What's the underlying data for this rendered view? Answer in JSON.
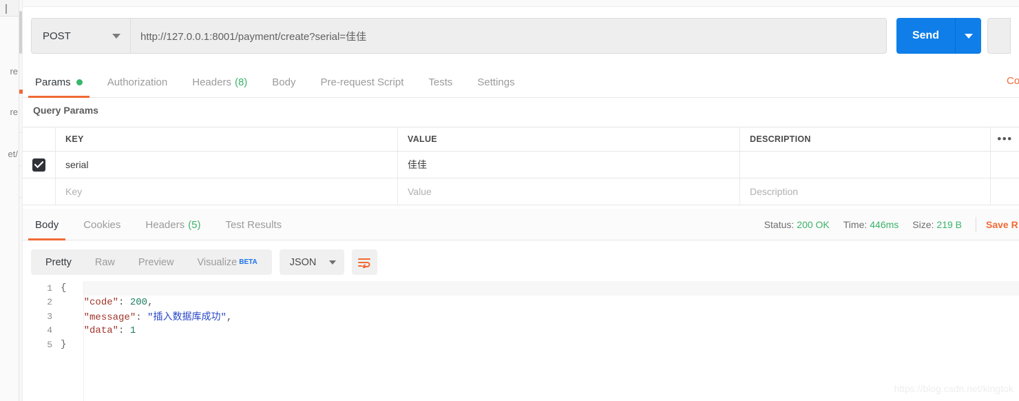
{
  "sidebar": {
    "clipped_labels": [
      "re",
      "re",
      "et/"
    ]
  },
  "request": {
    "method": "POST",
    "method_caret_icon": "chevron-down-icon",
    "url": "http://127.0.0.1:8001/payment/create?serial=佳佳",
    "send_label": "Send",
    "send_caret_icon": "chevron-down-icon"
  },
  "request_tabs": [
    {
      "label": "Params",
      "badge": "",
      "dot": true,
      "active": true
    },
    {
      "label": "Authorization",
      "badge": "",
      "dot": false,
      "active": false
    },
    {
      "label": "Headers",
      "badge": "(8)",
      "dot": false,
      "active": false
    },
    {
      "label": "Body",
      "badge": "",
      "dot": false,
      "active": false
    },
    {
      "label": "Pre-request Script",
      "badge": "",
      "dot": false,
      "active": false
    },
    {
      "label": "Tests",
      "badge": "",
      "dot": false,
      "active": false
    },
    {
      "label": "Settings",
      "badge": "",
      "dot": false,
      "active": false
    }
  ],
  "cookies_link": "Co",
  "query_params": {
    "title": "Query Params",
    "columns": [
      "KEY",
      "VALUE",
      "DESCRIPTION"
    ],
    "bulk_edit_icon": "ellipsis-icon",
    "rows": [
      {
        "checked": true,
        "key": "serial",
        "value": "佳佳",
        "description": ""
      }
    ],
    "placeholder_row": {
      "key": "Key",
      "value": "Value",
      "description": "Description"
    }
  },
  "response_tabs": [
    {
      "label": "Body",
      "badge": "",
      "active": true
    },
    {
      "label": "Cookies",
      "badge": "",
      "active": false
    },
    {
      "label": "Headers",
      "badge": "(5)",
      "active": false
    },
    {
      "label": "Test Results",
      "badge": "",
      "active": false
    }
  ],
  "response_meta": {
    "status_label": "Status:",
    "status_value": "200 OK",
    "time_label": "Time:",
    "time_value": "446ms",
    "size_label": "Size:",
    "size_value": "219 B",
    "save_response_label": "Save R"
  },
  "viewer": {
    "modes": [
      {
        "label": "Pretty",
        "active": true,
        "beta": ""
      },
      {
        "label": "Raw",
        "active": false,
        "beta": ""
      },
      {
        "label": "Preview",
        "active": false,
        "beta": ""
      },
      {
        "label": "Visualize",
        "active": false,
        "beta": "BETA"
      }
    ],
    "format": "JSON",
    "format_caret_icon": "chevron-down-icon",
    "wrap_icon": "wrap-text-icon"
  },
  "response_body": {
    "language": "json",
    "lines": [
      {
        "no": "1",
        "text": "{"
      },
      {
        "no": "2",
        "text": "    \"code\": 200,"
      },
      {
        "no": "3",
        "text": "    \"message\": \"插入数据库成功\","
      },
      {
        "no": "4",
        "text": "    \"data\": 1"
      },
      {
        "no": "5",
        "text": "}"
      }
    ],
    "parsed": {
      "code": 200,
      "message": "插入数据库成功",
      "data": 1
    }
  },
  "watermark": "https://blog.csdn.net/kingtok",
  "colors": {
    "accent_orange": "#f06a35",
    "send_blue": "#0f7ee8",
    "status_green": "#39b36a",
    "beta_blue": "#1a73e8"
  }
}
